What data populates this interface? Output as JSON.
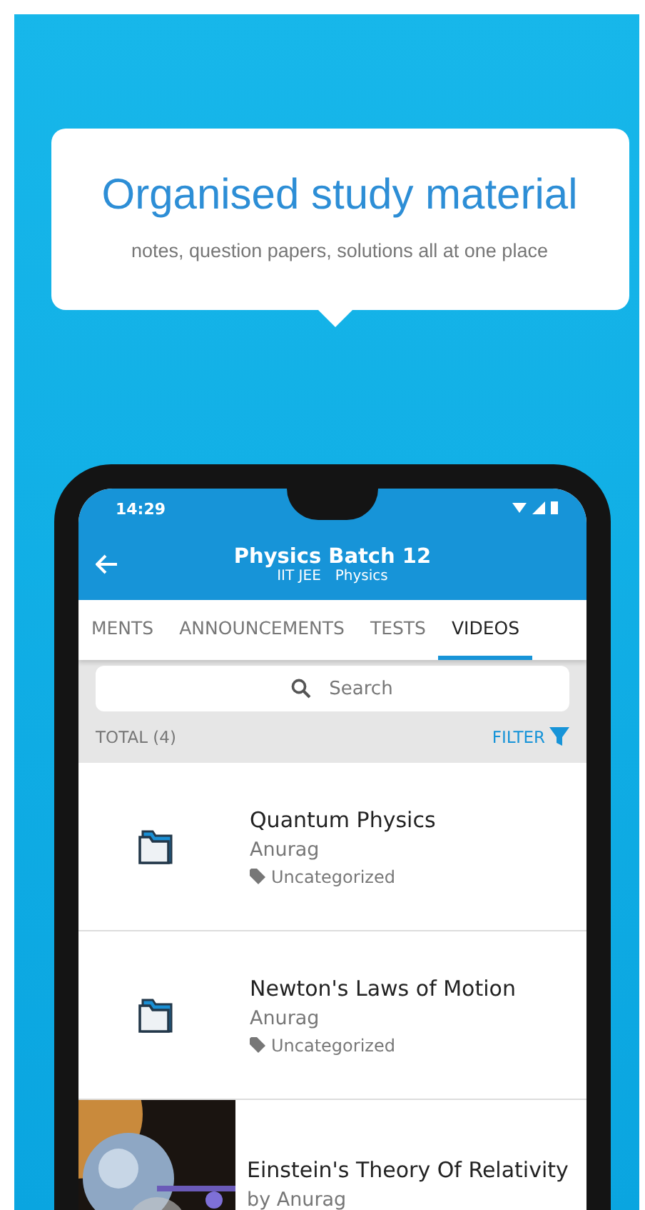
{
  "banner": {
    "title": "Organised study material",
    "subtitle": "notes, question papers, solutions all at one place"
  },
  "status_bar": {
    "time": "14:29"
  },
  "app_bar": {
    "title": "Physics Batch 12",
    "tags": [
      "IIT JEE",
      "Physics"
    ]
  },
  "tabs": [
    {
      "label": "MENTS",
      "selected": false
    },
    {
      "label": "ANNOUNCEMENTS",
      "selected": false
    },
    {
      "label": "TESTS",
      "selected": false
    },
    {
      "label": "VIDEOS",
      "selected": true
    }
  ],
  "search": {
    "placeholder": "Search"
  },
  "summary": {
    "total": "TOTAL (4)",
    "filter": "FILTER"
  },
  "items": [
    {
      "kind": "folder",
      "title": "Quantum Physics",
      "author": "Anurag",
      "tag": "Uncategorized"
    },
    {
      "kind": "folder",
      "title": "Newton's Laws of Motion",
      "author": "Anurag",
      "tag": "Uncategorized"
    },
    {
      "kind": "video",
      "title": "Einstein's Theory Of Relativity",
      "author": "by Anurag"
    }
  ]
}
